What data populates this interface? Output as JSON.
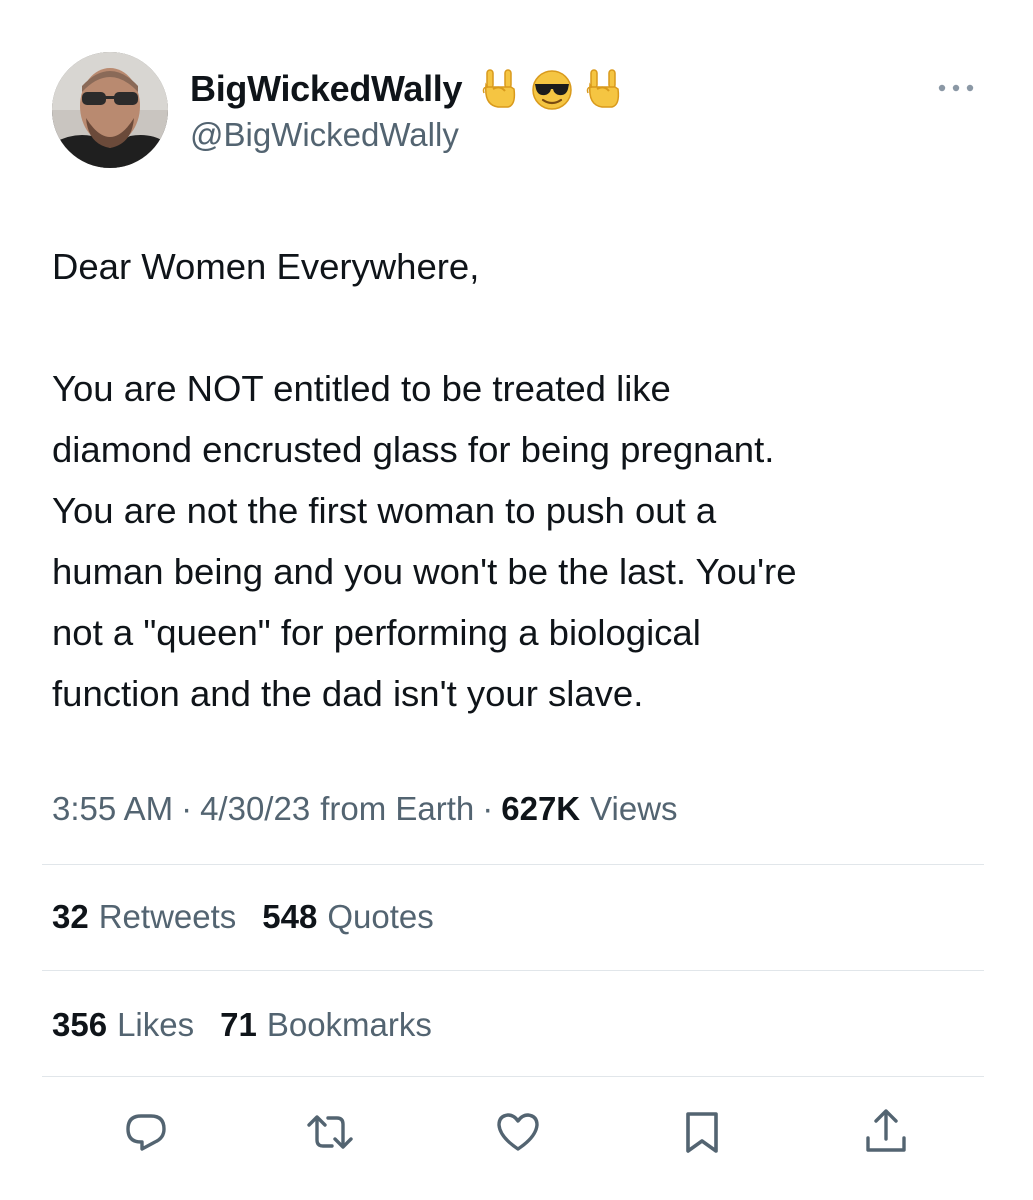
{
  "author": {
    "display_name": "BigWickedWally",
    "handle": "@BigWickedWally",
    "name_emojis": [
      "rock-on-hand-emoji",
      "sunglasses-face-emoji",
      "rock-on-hand-emoji"
    ]
  },
  "tweet": {
    "lines": [
      "Dear Women Everywhere,",
      "",
      "You are NOT entitled to be treated like",
      "diamond encrusted glass for being pregnant.",
      "You are not the first woman to push out a",
      "human being and you won't be the last. You're",
      "not a \"queen\" for performing a biological",
      "function and the dad isn't your slave."
    ]
  },
  "meta": {
    "time": "3:55 AM",
    "date": "4/30/23",
    "source": "from Earth",
    "separator": "·",
    "views_count": "627K",
    "views_label": "Views"
  },
  "stats": {
    "retweets_count": "32",
    "retweets_label": "Retweets",
    "quotes_count": "548",
    "quotes_label": "Quotes",
    "likes_count": "356",
    "likes_label": "Likes",
    "bookmarks_count": "71",
    "bookmarks_label": "Bookmarks"
  },
  "actions": [
    "reply-icon",
    "retweet-icon",
    "like-icon",
    "bookmark-icon",
    "share-icon"
  ],
  "colors": {
    "text": "#0f1419",
    "secondary": "#536471",
    "divider": "#e1e6ea",
    "icon": "#536471"
  }
}
